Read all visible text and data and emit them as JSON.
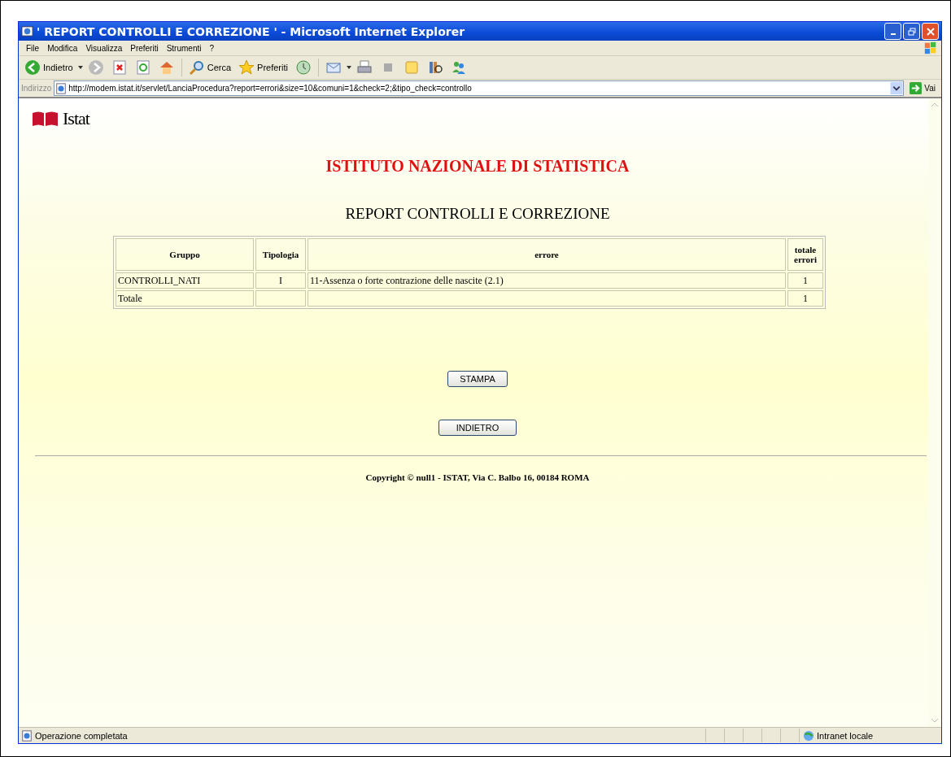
{
  "window": {
    "title": "' REPORT CONTROLLI E CORREZIONE ' - Microsoft Internet Explorer"
  },
  "menu": [
    "File",
    "Modifica",
    "Visualizza",
    "Preferiti",
    "Strumenti",
    "?"
  ],
  "toolbar": {
    "back": "Indietro",
    "search": "Cerca",
    "favorites": "Preferiti"
  },
  "address": {
    "label": "Indirizzo",
    "url": "http://modem.istat.it/servlet/LanciaProcedura?report=errori&size=10&comuni=1&check=2;&tipo_check=controllo",
    "go": "Vai"
  },
  "page": {
    "logo": "Istat",
    "heading": "ISTITUTO NAZIONALE DI STATISTICA",
    "subtitle": "REPORT CONTROLLI E CORREZIONE",
    "table": {
      "columns": [
        "Gruppo",
        "Tipologia",
        "errore",
        "totale errori"
      ],
      "rows": [
        [
          "CONTROLLI_NATI",
          "I",
          "11-Assenza o forte contrazione delle nascite (2.1)",
          "1"
        ],
        [
          "Totale",
          "",
          "",
          "1"
        ]
      ]
    },
    "buttons": [
      "STAMPA",
      "INDIETRO"
    ],
    "copyright": "Copyright © null1 - ISTAT, Via C. Balbo 16, 00184 ROMA"
  },
  "status_bar": {
    "text": "Operazione completata",
    "zone": "Intranet locale"
  }
}
